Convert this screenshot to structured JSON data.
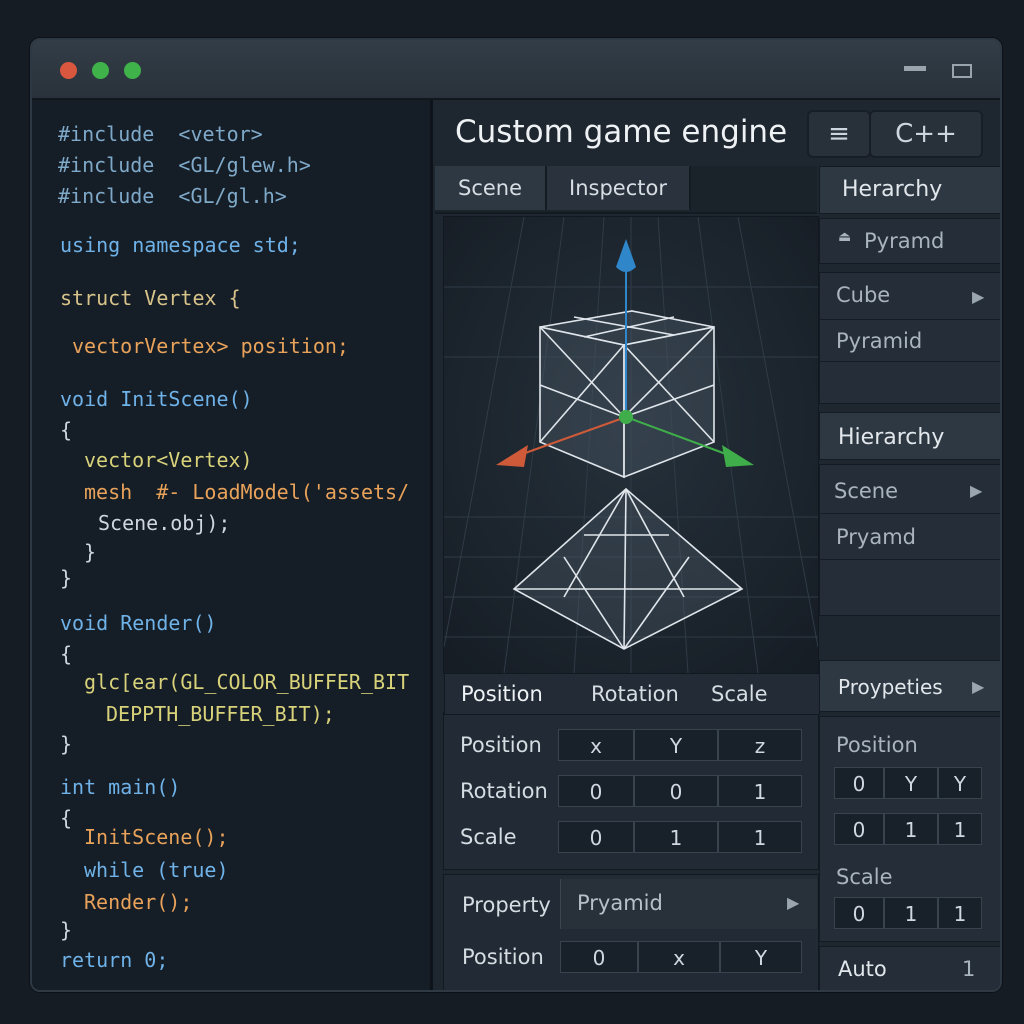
{
  "window": {
    "controls": [
      "close",
      "minimize",
      "maximize"
    ]
  },
  "code": {
    "lines": [
      "#include  <vetor>",
      "#include  <GL/glew.h>",
      "#include  <GL/gl.h>",
      "using namespace std;",
      "struct Vertex {",
      "vectorVertex> position;",
      "void InitScene()",
      "{",
      "vector<Vertex)",
      "mesh  #- LoadModel('assets/",
      "Scene.obj);",
      "}",
      "}",
      "void Render()",
      "{",
      "glc[ear(GL_COLOR_BUFFER_BIT",
      "DEPPTH_BUFFER_BIT);",
      "}",
      "int main()",
      "{",
      "InitScene();",
      "while (true)",
      "Render();",
      "}",
      "return 0;"
    ]
  },
  "header": {
    "title": "Custom game engine",
    "menu_icon": "≡",
    "language": "C++"
  },
  "tabs": [
    "Scene",
    "Inspector"
  ],
  "transform": {
    "tabs": [
      "Position",
      "Rotation",
      "Scale"
    ],
    "rows": [
      {
        "label": "Position",
        "values": [
          "x",
          "Y",
          "z"
        ]
      },
      {
        "label": "Rotation",
        "values": [
          "0",
          "0",
          "1"
        ]
      },
      {
        "label": "Scale",
        "values": [
          "0",
          "1",
          "1"
        ]
      }
    ]
  },
  "property": {
    "label": "Property",
    "value": "Pryamid",
    "position_label": "Position",
    "position_values": [
      "0",
      "x",
      "Y"
    ]
  },
  "sidebar": {
    "hierarchy1_title": "Herarchy",
    "hierarchy1_sub": "Pyramd",
    "hierarchy1_items": [
      "Cube",
      "Pyramid"
    ],
    "hierarchy2_title": "Hierarchy",
    "hierarchy2_items": [
      "Scene",
      "Pryamd"
    ],
    "properties_title": "Proypeties",
    "position_label": "Position",
    "position_rows": [
      [
        "0",
        "Y",
        "Y"
      ],
      [
        "0",
        "1",
        "1"
      ]
    ],
    "scale_label": "Scale",
    "scale_values": [
      "0",
      "1",
      "1"
    ],
    "auto_label": "Auto",
    "auto_value": "1"
  },
  "colors": {
    "accent_blue": "#2f86c9",
    "accent_red": "#cf5a3a",
    "accent_green": "#3fae4a"
  }
}
